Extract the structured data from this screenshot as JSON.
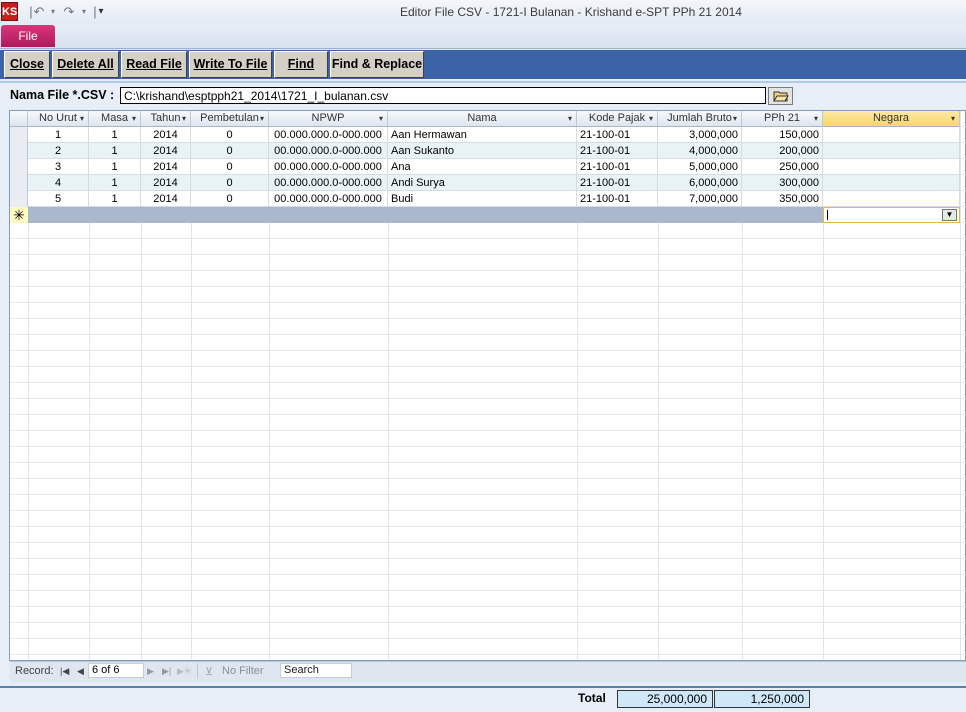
{
  "window": {
    "title": "Editor File CSV - 1721-I Bulanan  -  Krishand e-SPT PPh 21 2014",
    "logo_text": "KS"
  },
  "ribbon": {
    "file_tab": "File"
  },
  "toolbar": {
    "close": "Close",
    "delete_all": "Delete All",
    "read_file": "Read File",
    "write_to_file": "Write To File",
    "find": "Find",
    "find_replace": "Find & Replace"
  },
  "file": {
    "label": "Nama File *.CSV :",
    "path": "C:\\krishand\\esptpph21_2014\\1721_I_bulanan.csv"
  },
  "columns": [
    "No Urut",
    "Masa",
    "Tahun",
    "Pembetulan",
    "NPWP",
    "Nama",
    "Kode Pajak",
    "Jumlah Bruto",
    "PPh 21",
    "Negara"
  ],
  "rows": [
    {
      "no": "1",
      "masa": "1",
      "tahun": "2014",
      "pembetulan": "0",
      "npwp": "00.000.000.0-000.000",
      "nama": "Aan Hermawan",
      "kode": "21-100-01",
      "bruto": "3,000,000",
      "pph": "150,000",
      "negara": ""
    },
    {
      "no": "2",
      "masa": "1",
      "tahun": "2014",
      "pembetulan": "0",
      "npwp": "00.000.000.0-000.000",
      "nama": "Aan Sukanto",
      "kode": "21-100-01",
      "bruto": "4,000,000",
      "pph": "200,000",
      "negara": ""
    },
    {
      "no": "3",
      "masa": "1",
      "tahun": "2014",
      "pembetulan": "0",
      "npwp": "00.000.000.0-000.000",
      "nama": "Ana",
      "kode": "21-100-01",
      "bruto": "5,000,000",
      "pph": "250,000",
      "negara": ""
    },
    {
      "no": "4",
      "masa": "1",
      "tahun": "2014",
      "pembetulan": "0",
      "npwp": "00.000.000.0-000.000",
      "nama": "Andi Surya",
      "kode": "21-100-01",
      "bruto": "6,000,000",
      "pph": "300,000",
      "negara": ""
    },
    {
      "no": "5",
      "masa": "1",
      "tahun": "2014",
      "pembetulan": "0",
      "npwp": "00.000.000.0-000.000",
      "nama": "Budi",
      "kode": "21-100-01",
      "bruto": "7,000,000",
      "pph": "350,000",
      "negara": ""
    }
  ],
  "new_row_marker": "✳",
  "navigator": {
    "record_label": "Record:",
    "current": "6 of 6",
    "filter": "No Filter",
    "search": "Search"
  },
  "totals": {
    "label": "Total",
    "bruto": "25,000,000",
    "pph": "1,250,000"
  },
  "colors": {
    "toolbar_bg": "#3c63a8",
    "file_tab": "#c2246a",
    "header_active": "#f9d66a",
    "alt_row": "#e8f3f6",
    "total_box": "#cfe8f7"
  }
}
